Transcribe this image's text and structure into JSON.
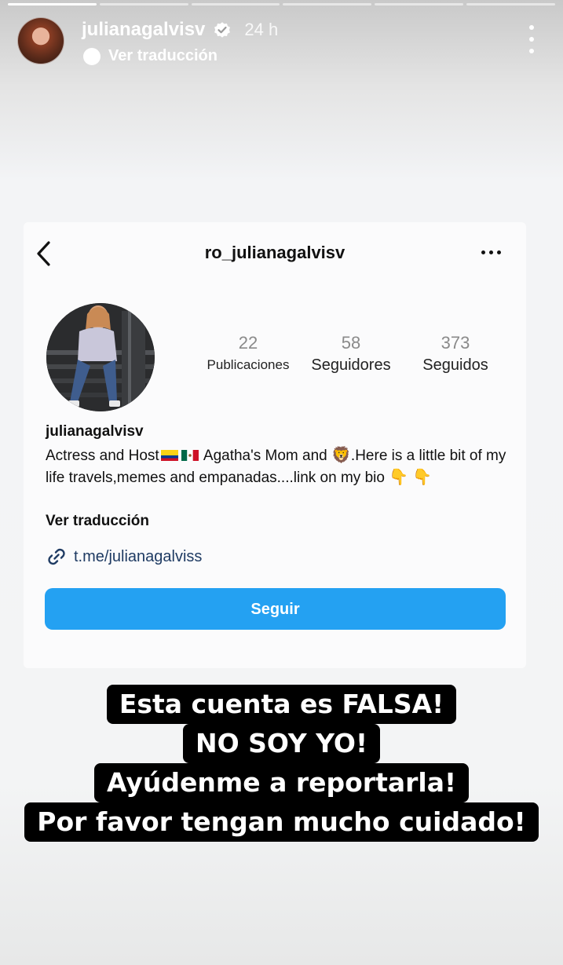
{
  "story": {
    "segments": 6,
    "segments_done": 1,
    "username": "julianagalvisv",
    "verified": true,
    "time": "24 h",
    "translate_label": "Ver traducción"
  },
  "profile": {
    "handle": "ro_julianagalvisv",
    "stats": [
      {
        "value": "22",
        "label": "Publicaciones"
      },
      {
        "value": "58",
        "label": "Seguidores"
      },
      {
        "value": "373",
        "label": "Seguidos"
      }
    ],
    "name": "julianagalvisv",
    "bio": {
      "part1": "Actress and Host",
      "part2": "Agatha's Mom and",
      "part3": ".Here is a little bit of my life travels,memes and empanadas....link on my bio",
      "emoji_lion": "🦁",
      "emoji_down": "👇"
    },
    "translate_label": "Ver traducción",
    "link": "t.me/julianagalviss",
    "follow_label": "Seguir"
  },
  "caption": {
    "lines": [
      "Esta cuenta es FALSA!",
      "NO SOY YO!",
      "Ayúdenme a reportarla!",
      "Por favor tengan mucho cuidado!"
    ]
  },
  "colors": {
    "follow_button": "#24a1f2",
    "caption_bg": "#000000"
  }
}
